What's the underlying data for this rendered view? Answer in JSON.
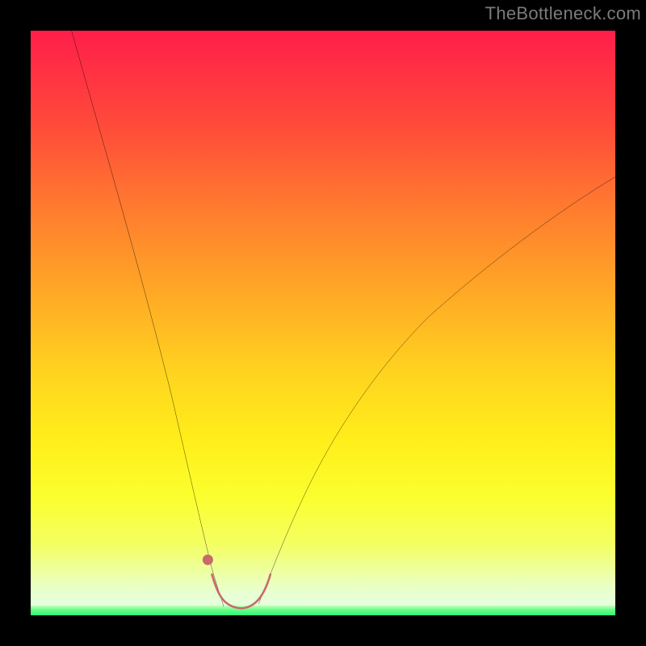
{
  "watermark": {
    "text": "TheBottleneck.com"
  },
  "chart_data": {
    "type": "line",
    "title": "",
    "xlabel": "",
    "ylabel": "",
    "xlim": [
      0,
      100
    ],
    "ylim": [
      0,
      100
    ],
    "grid": false,
    "legend": false,
    "series": [
      {
        "name": "left-curve",
        "color": "#000000",
        "x": [
          7,
          10,
          13,
          16,
          19,
          22,
          24,
          26,
          28,
          29.5,
          31,
          32,
          33
        ],
        "y": [
          100,
          87,
          74,
          61,
          49,
          38,
          29,
          21,
          14,
          9,
          5,
          3,
          1.5
        ]
      },
      {
        "name": "right-curve",
        "color": "#000000",
        "x": [
          39,
          41,
          44,
          48,
          52,
          57,
          63,
          70,
          78,
          86,
          94,
          100
        ],
        "y": [
          2,
          6,
          13,
          22,
          30,
          38,
          46,
          54,
          61,
          67,
          72,
          75
        ]
      },
      {
        "name": "bottom-thick-curve",
        "color": "#c76a6a",
        "x": [
          31,
          32.5,
          34,
          36,
          38,
          39.5,
          41
        ],
        "y": [
          7,
          3,
          1.5,
          1,
          1.5,
          3,
          7
        ]
      },
      {
        "name": "left-marker",
        "color": "#c76a6a",
        "x": [
          30.3
        ],
        "y": [
          9.5
        ]
      }
    ],
    "background_gradient": {
      "stops": [
        {
          "pos": 0.0,
          "color": "#ff1e4a"
        },
        {
          "pos": 0.3,
          "color": "#ff7a2f"
        },
        {
          "pos": 0.58,
          "color": "#ffd21f"
        },
        {
          "pos": 0.8,
          "color": "#fbff2f"
        },
        {
          "pos": 0.96,
          "color": "#e8ffd0"
        },
        {
          "pos": 1.0,
          "color": "#2bf57a"
        }
      ]
    }
  }
}
